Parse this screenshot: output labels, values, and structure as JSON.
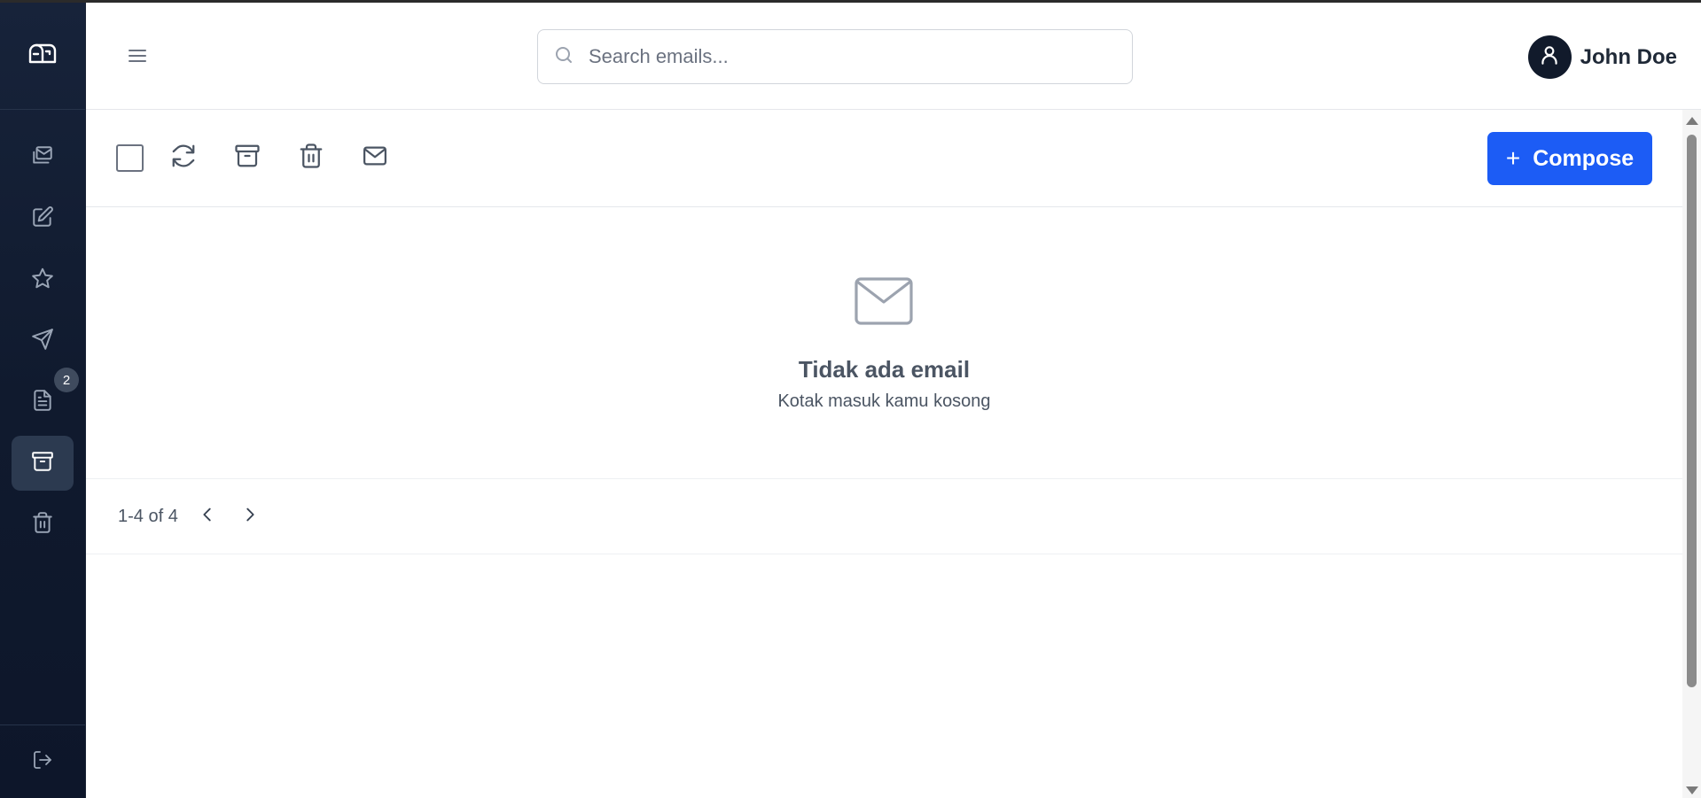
{
  "app": {
    "logo_icon": "mailbox-logo-icon"
  },
  "sidebar": {
    "items": [
      {
        "name": "inbox",
        "icon": "inbox-mail-icon",
        "active": false
      },
      {
        "name": "compose",
        "icon": "edit-icon",
        "active": false
      },
      {
        "name": "starred",
        "icon": "star-icon",
        "active": false
      },
      {
        "name": "sent",
        "icon": "send-icon",
        "active": false
      },
      {
        "name": "drafts",
        "icon": "document-icon",
        "active": false,
        "badge": "2"
      },
      {
        "name": "archive",
        "icon": "archive-icon",
        "active": true
      },
      {
        "name": "trash",
        "icon": "trash-icon",
        "active": false
      }
    ],
    "logout_icon": "logout-icon"
  },
  "header": {
    "search_placeholder": "Search emails...",
    "user_name": "John Doe"
  },
  "toolbar": {
    "compose_label": "Compose",
    "compose_icon": "+",
    "tools": [
      "refresh-icon",
      "archive-icon",
      "trash-icon",
      "mail-icon"
    ]
  },
  "empty_state": {
    "title": "Tidak ada email",
    "subtitle": "Kotak masuk kamu kosong"
  },
  "pagination": {
    "range_text": "1-4 of 4"
  },
  "colors": {
    "sidebar_bg": "#101a2e",
    "accent": "#1c5cf5",
    "active_item": "#2c3a50"
  }
}
